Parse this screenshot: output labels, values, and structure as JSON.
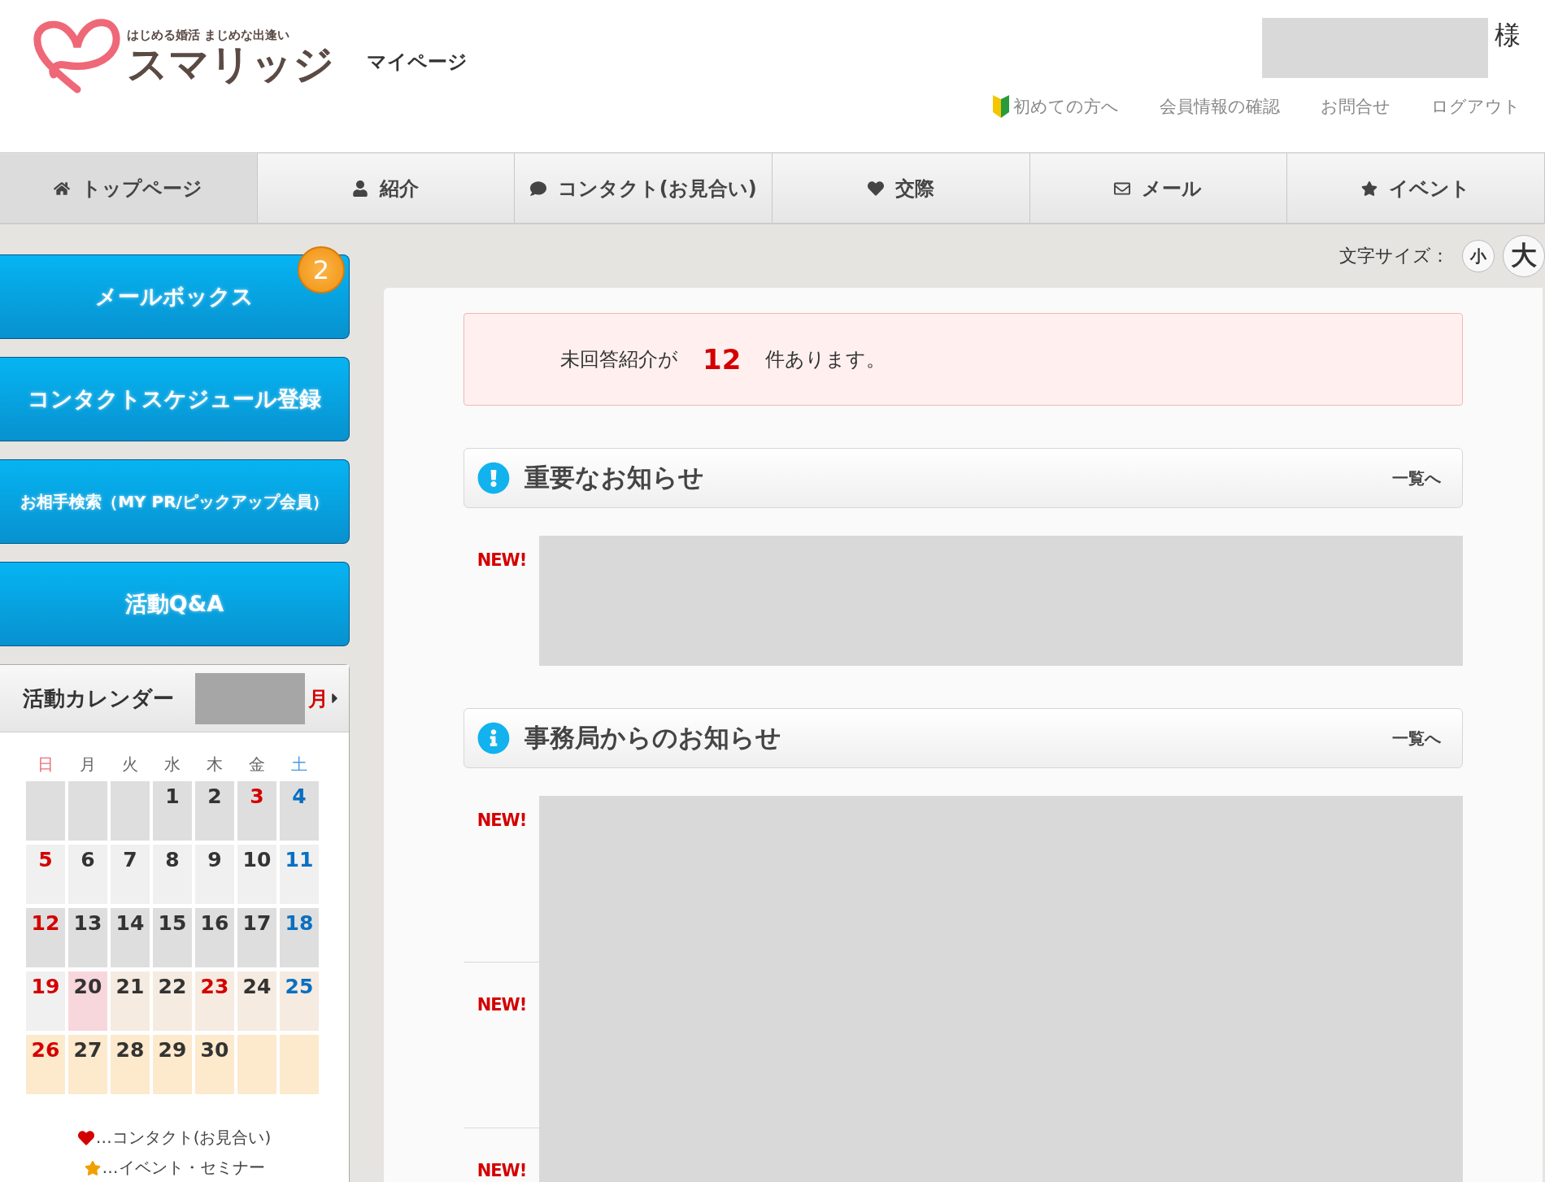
{
  "header": {
    "logo": {
      "tagline": "はじめる婚活 まじめな出逢い",
      "name": "スマリッジ"
    },
    "page_title": "マイページ",
    "user_suffix": "様",
    "links": [
      {
        "label": "初めての方へ",
        "kind": "beginner"
      },
      {
        "label": "会員情報の確認",
        "kind": "plain"
      },
      {
        "label": "お問合せ",
        "kind": "plain"
      },
      {
        "label": "ログアウト",
        "kind": "plain"
      }
    ]
  },
  "nav": [
    {
      "label": "トップページ",
      "selected": true
    },
    {
      "label": "紹介",
      "selected": false
    },
    {
      "label": "コンタクト(お見合い)",
      "selected": false
    },
    {
      "label": "交際",
      "selected": false
    },
    {
      "label": "メール",
      "selected": false
    },
    {
      "label": "イベント",
      "selected": false
    }
  ],
  "sidebar": {
    "buttons": [
      {
        "label": "メールボックス",
        "badge": "2"
      },
      {
        "label": "コンタクトスケジュール登録"
      },
      {
        "label": "お相手検索（MY PR/ピックアップ会員）"
      },
      {
        "label": "活動Q&A"
      }
    ],
    "calendar": {
      "title": "活動カレンダー",
      "month_suffix": "月",
      "weekdays": [
        {
          "label": "日",
          "kind": "sunday"
        },
        {
          "label": "月",
          "kind": "weekday"
        },
        {
          "label": "火",
          "kind": "weekday"
        },
        {
          "label": "水",
          "kind": "weekday"
        },
        {
          "label": "木",
          "kind": "weekday"
        },
        {
          "label": "金",
          "kind": "weekday"
        },
        {
          "label": "土",
          "kind": "saturday"
        }
      ],
      "weeks": [
        [
          {
            "color": "#dedede"
          },
          {
            "color": "#dedede"
          },
          {
            "color": "#dedede"
          },
          {
            "day": "1",
            "kind": "weekday",
            "color": "#dedede"
          },
          {
            "day": "2",
            "kind": "weekday",
            "color": "#dedede"
          },
          {
            "day": "3",
            "kind": "holiday",
            "color": "#dedede"
          },
          {
            "day": "4",
            "kind": "saturday",
            "color": "#dedede"
          }
        ],
        [
          {
            "day": "5",
            "kind": "sunday",
            "color": "#f0f0f0"
          },
          {
            "day": "6",
            "kind": "weekday",
            "color": "#f0f0f0"
          },
          {
            "day": "7",
            "kind": "weekday",
            "color": "#f0f0f0"
          },
          {
            "day": "8",
            "kind": "weekday",
            "color": "#f0f0f0"
          },
          {
            "day": "9",
            "kind": "weekday",
            "color": "#f0f0f0"
          },
          {
            "day": "10",
            "kind": "weekday",
            "color": "#f0f0f0"
          },
          {
            "day": "11",
            "kind": "saturday",
            "color": "#f0f0f0"
          }
        ],
        [
          {
            "day": "12",
            "kind": "sunday",
            "color": "#dedede"
          },
          {
            "day": "13",
            "kind": "weekday",
            "color": "#dedede"
          },
          {
            "day": "14",
            "kind": "weekday",
            "color": "#dedede"
          },
          {
            "day": "15",
            "kind": "weekday",
            "color": "#dedede"
          },
          {
            "day": "16",
            "kind": "weekday",
            "color": "#dedede"
          },
          {
            "day": "17",
            "kind": "weekday",
            "color": "#dedede"
          },
          {
            "day": "18",
            "kind": "saturday",
            "color": "#dedede"
          }
        ],
        [
          {
            "day": "19",
            "kind": "sunday",
            "color": "#f0f0f0"
          },
          {
            "day": "20",
            "kind": "weekday",
            "color": "#f7d7dc"
          },
          {
            "day": "21",
            "kind": "weekday",
            "color": "#f5ebe0"
          },
          {
            "day": "22",
            "kind": "weekday",
            "color": "#f5ebe0"
          },
          {
            "day": "23",
            "kind": "holiday",
            "color": "#f5ebe0"
          },
          {
            "day": "24",
            "kind": "weekday",
            "color": "#f5ebe0"
          },
          {
            "day": "25",
            "kind": "saturday",
            "color": "#f5ebe0"
          }
        ],
        [
          {
            "day": "26",
            "kind": "sunday",
            "color": "#fde9cc"
          },
          {
            "day": "27",
            "kind": "weekday",
            "color": "#fde9cc"
          },
          {
            "day": "28",
            "kind": "weekday",
            "color": "#fde9cc"
          },
          {
            "day": "29",
            "kind": "weekday",
            "color": "#fde9cc"
          },
          {
            "day": "30",
            "kind": "weekday",
            "color": "#fde9cc"
          },
          {
            "color": "#fde9cc"
          },
          {
            "color": "#fde9cc"
          }
        ]
      ],
      "legend": [
        {
          "label": "…コンタクト(お見合い)",
          "kind": "heart"
        },
        {
          "label": "…イベント・セミナー",
          "kind": "star"
        }
      ]
    }
  },
  "font_size": {
    "label": "文字サイズ：",
    "options": [
      {
        "label": "小",
        "selected": false
      },
      {
        "label": "大",
        "selected": true
      }
    ]
  },
  "alert": {
    "prefix": "未回答紹介が",
    "count": "12",
    "suffix": "件あります。"
  },
  "sections": [
    {
      "title": "重要なお知らせ",
      "kind": "important",
      "more": "一覧へ",
      "badges": [
        "NEW!"
      ]
    },
    {
      "title": "事務局からのお知らせ",
      "kind": "info",
      "more": "一覧へ",
      "badges": [
        "NEW!",
        "NEW!",
        "NEW!"
      ]
    }
  ]
}
